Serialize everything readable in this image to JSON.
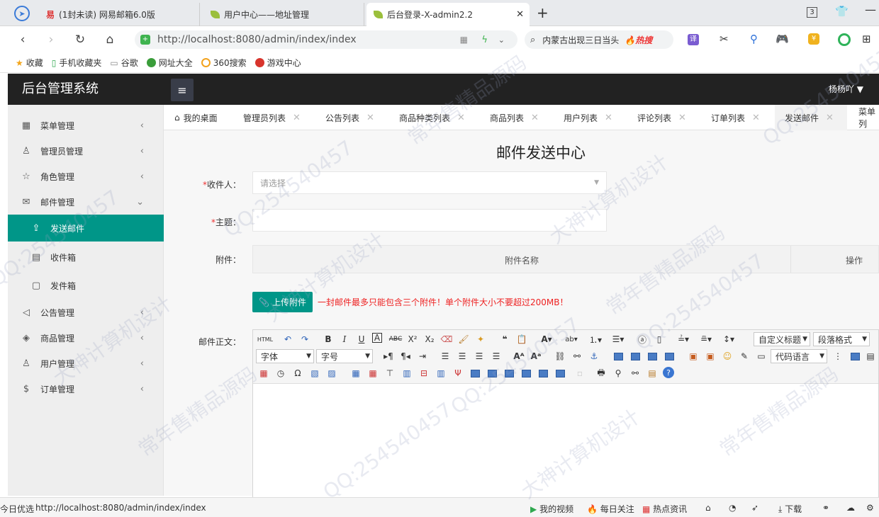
{
  "browser": {
    "tabs": [
      {
        "label": "(1封未读) 网易邮箱6.0版"
      },
      {
        "label": "用户中心——地址管理"
      },
      {
        "label": "后台登录-X-admin2.2"
      }
    ],
    "tab_count": "3",
    "url": "http://localhost:8080/admin/index/index",
    "search_text": "内蒙古出现三日当头",
    "hot_badge": "热搜",
    "bookmarks": [
      "收藏",
      "手机收藏夹",
      "谷歌",
      "网址大全",
      "360搜索",
      "游戏中心"
    ]
  },
  "app": {
    "title": "后台管理系统",
    "user": "杨杨吖"
  },
  "sidebar": {
    "items": [
      {
        "label": "菜单管理",
        "icon": "grid-icon"
      },
      {
        "label": "管理员管理",
        "icon": "user-group-icon"
      },
      {
        "label": "角色管理",
        "icon": "star-icon"
      },
      {
        "label": "邮件管理",
        "icon": "mail-icon"
      },
      {
        "label": "发送邮件",
        "icon": "send-icon"
      },
      {
        "label": "收件箱",
        "icon": "inbox-icon"
      },
      {
        "label": "发件箱",
        "icon": "outbox-icon"
      },
      {
        "label": "公告管理",
        "icon": "speaker-icon"
      },
      {
        "label": "商品管理",
        "icon": "box-icon"
      },
      {
        "label": "用户管理",
        "icon": "user-icon"
      },
      {
        "label": "订单管理",
        "icon": "dollar-icon"
      }
    ]
  },
  "page_tabs": [
    {
      "label": "我的桌面"
    },
    {
      "label": "管理员列表"
    },
    {
      "label": "公告列表"
    },
    {
      "label": "商品种类列表"
    },
    {
      "label": "商品列表"
    },
    {
      "label": "用户列表"
    },
    {
      "label": "评论列表"
    },
    {
      "label": "订单列表"
    },
    {
      "label": "发送邮件"
    },
    {
      "label": "菜单列"
    }
  ],
  "form": {
    "title": "邮件发送中心",
    "recipient_label": "收件人：",
    "recipient_placeholder": "请选择",
    "subject_label": "主题：",
    "attachment_label": "附件：",
    "attachment_col_name": "附件名称",
    "attachment_col_ops": "操作",
    "upload_label": "上传附件",
    "upload_tip": "一封邮件最多只能包含三个附件！单个附件大小不要超过200MB！",
    "body_label": "邮件正文：",
    "required_mark": "*"
  },
  "editor": {
    "html_btn": "HTML",
    "custom_title": "自定义标题",
    "paragraph_format": "段落格式",
    "font_family": "字体",
    "font_size": "字号",
    "code_lang": "代码语言"
  },
  "statusbar": {
    "left_text": "今日优选",
    "url": "http://localhost:8080/admin/index/index",
    "items": [
      "我的视频",
      "每日关注",
      "热点资讯",
      "下载"
    ]
  },
  "watermarks": [
    "QQ:254540457",
    "大神计算机设计",
    "常年售精品源码"
  ]
}
